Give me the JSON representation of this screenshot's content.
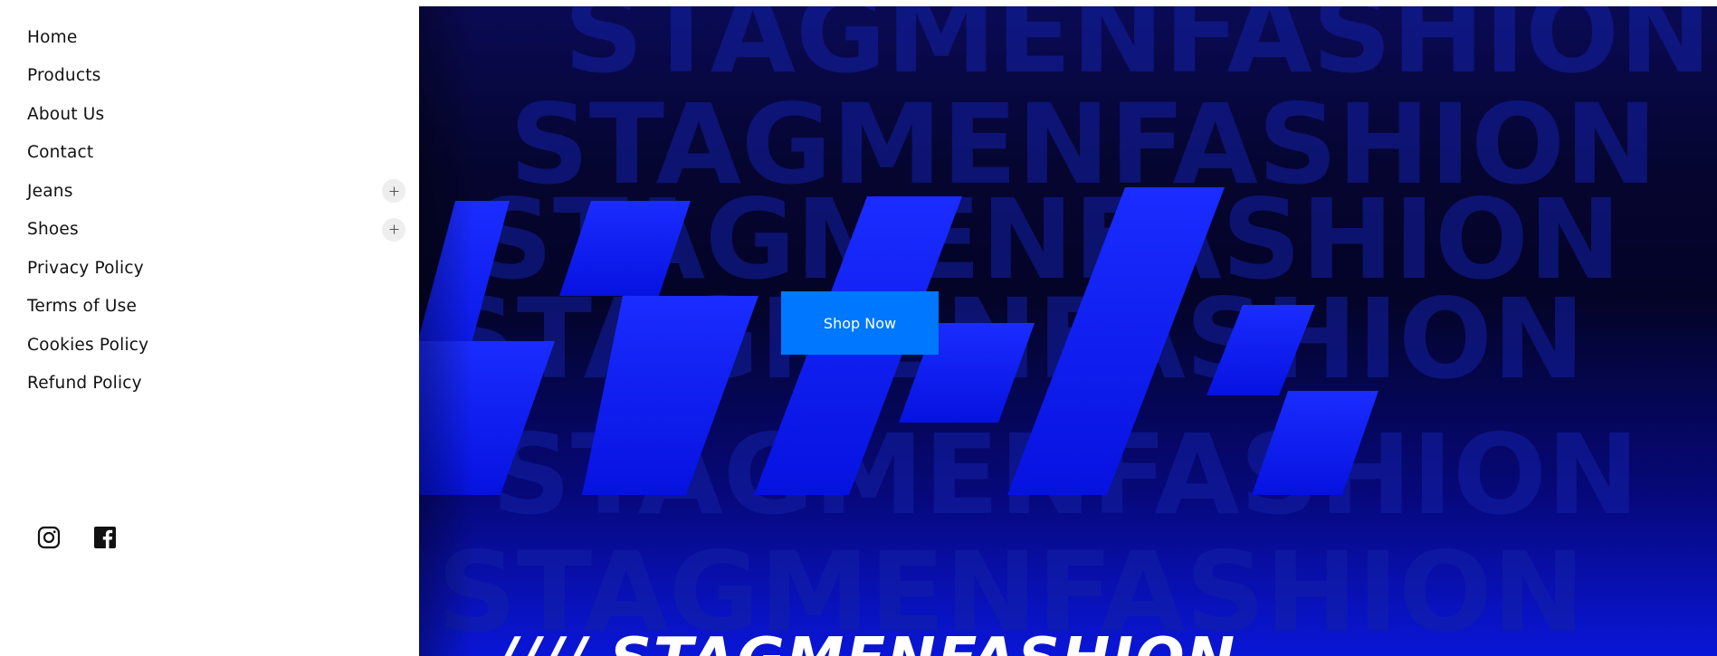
{
  "sidebar": {
    "items": [
      {
        "label": "Home",
        "expandable": false
      },
      {
        "label": "Products",
        "expandable": false
      },
      {
        "label": "About Us",
        "expandable": false
      },
      {
        "label": "Contact",
        "expandable": false
      },
      {
        "label": "Jeans",
        "expandable": true,
        "expand_icon": "plus-icon"
      },
      {
        "label": "Shoes",
        "expandable": true,
        "expand_icon": "plus-icon"
      },
      {
        "label": "Privacy Policy",
        "expandable": false
      },
      {
        "label": "Terms of Use",
        "expandable": false
      },
      {
        "label": "Cookies Policy",
        "expandable": false
      },
      {
        "label": "Refund Policy",
        "expandable": false
      }
    ],
    "socials": [
      "instagram-icon",
      "facebook-icon"
    ]
  },
  "hero": {
    "background_text": "STAGMENFASHION",
    "cta_label": "Shop Now",
    "title": "//// STAGMENFASHION",
    "colors": {
      "cta": "#0077ff",
      "stripes": "#0a1cff",
      "background_dark": "#040428",
      "background_bright": "#0a16d8"
    }
  }
}
